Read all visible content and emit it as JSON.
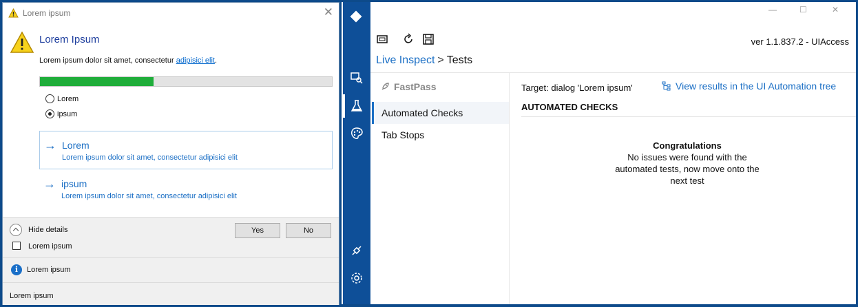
{
  "dialog": {
    "window_title": "Lorem ipsum",
    "main_instruction": "Lorem Ipsum",
    "content_text": "Lorem ipsum dolor sit amet, consectetur ",
    "content_link": "adipisici elit",
    "content_period": ".",
    "progress_fraction": 0.39,
    "progress_color": "#1fad3a",
    "radios": [
      {
        "label": "Lorem",
        "checked": false
      },
      {
        "label": "ipsum",
        "checked": true
      }
    ],
    "command_links": [
      {
        "title": "Lorem",
        "description": "Lorem ipsum dolor sit amet, consectetur adipisici elit"
      },
      {
        "title": "ipsum",
        "description": "Lorem ipsum dolor sit amet, consectetur adipisici elit"
      }
    ],
    "hide_details_label": "Hide details",
    "buttons": {
      "yes": "Yes",
      "no": "No"
    },
    "verification_label": "Lorem ipsum",
    "footer_info_label": "Lorem ipsum",
    "footer_bottom_label": "Lorem ipsum"
  },
  "app": {
    "version": "ver 1.1.837.2 - UIAccess",
    "breadcrumb": {
      "parent": "Live Inspect",
      "separator": ">",
      "current": "Tests"
    },
    "fastpass_label": "FastPass",
    "side_items": [
      {
        "label": "Automated Checks",
        "selected": true
      },
      {
        "label": "Tab Stops",
        "selected": false
      }
    ],
    "target_text": "Target: dialog 'Lorem ipsum'",
    "tree_link": "View results in the UI Automation tree",
    "section_heading": "AUTOMATED CHECKS",
    "congrats_title": "Congratulations",
    "congrats_body": "No issues were found with the automated tests, now move onto the next test",
    "accent_color": "#1b6fc5",
    "nav_color": "#0e4f98"
  }
}
